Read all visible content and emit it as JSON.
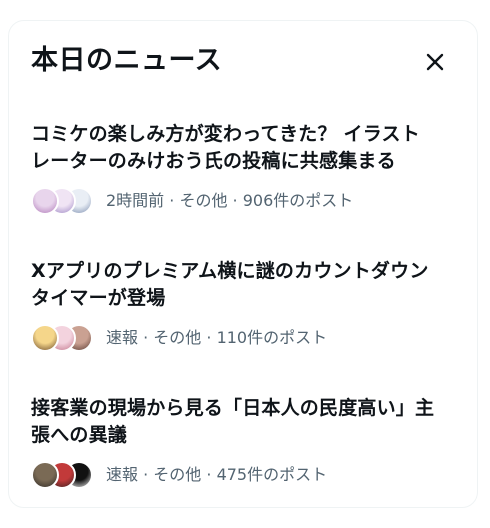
{
  "header": {
    "title": "本日のニュース",
    "close_icon": "close-icon"
  },
  "news": [
    {
      "title_line1": "コミケの楽しみ方が変わってきた？ イラスト",
      "title_line2": "レーターのみけおう氏の投稿に共感集まる",
      "time": "2時間前",
      "category": "その他",
      "posts": "906件のポスト",
      "avatar_colors": [
        [
          "#e8d5ec",
          "#b07ab9"
        ],
        [
          "#f0e4f4",
          "#9d87c4"
        ],
        [
          "#e9eef5",
          "#7d8fb0"
        ]
      ]
    },
    {
      "title_line1": "Xアプリのプレミアム横に謎のカウントダウン",
      "title_line2": "タイマーが登場",
      "time": "速報",
      "category": "その他",
      "posts": "110件のポスト",
      "avatar_colors": [
        [
          "#f5d68a",
          "#6b4a2a"
        ],
        [
          "#f3d3de",
          "#c2748a"
        ],
        [
          "#caa192",
          "#5a3a30"
        ]
      ]
    },
    {
      "title_line1": "接客業の現場から見る「日本人の民度高い」主",
      "title_line2": "張への異議",
      "time": "速報",
      "category": "その他",
      "posts": "475件のポスト",
      "avatar_colors": [
        [
          "#7a6a55",
          "#2f2a25"
        ],
        [
          "#c23a3a",
          "#3a2020"
        ],
        [
          "#111111",
          "#f5f5f5"
        ]
      ]
    }
  ],
  "separator": " · "
}
